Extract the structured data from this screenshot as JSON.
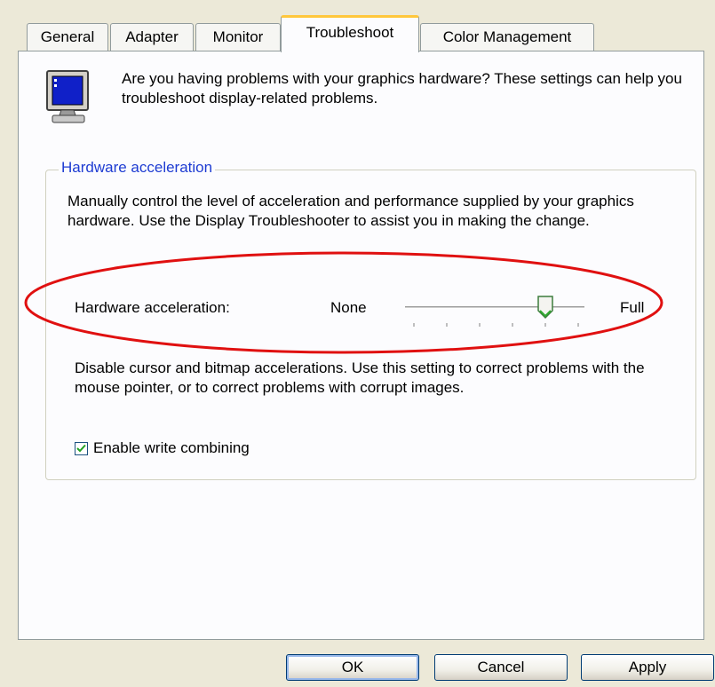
{
  "tabs": [
    {
      "label": "General"
    },
    {
      "label": "Adapter"
    },
    {
      "label": "Monitor"
    },
    {
      "label": "Troubleshoot",
      "active": true
    },
    {
      "label": "Color Management"
    }
  ],
  "intro_text": "Are you having problems with your graphics hardware? These settings can help you troubleshoot display-related problems.",
  "group": {
    "title": "Hardware acceleration",
    "description": "Manually control the level of acceleration and performance supplied by your graphics hardware. Use the Display Troubleshooter to assist you in making the change.",
    "slider_label": "Hardware acceleration:",
    "min_label": "None",
    "max_label": "Full",
    "slider_level": "5 of 6",
    "disable_text": "Disable cursor and bitmap accelerations. Use this setting to correct problems with the mouse pointer, or to correct problems with corrupt images.",
    "checkbox_label": "Enable write combining",
    "checkbox_checked": true
  },
  "buttons": {
    "ok": "OK",
    "cancel": "Cancel",
    "apply": "Apply"
  },
  "colors": {
    "highlight": "#E01010",
    "group_title": "#1E3CD2",
    "active_tab_accent": "#FFC73C"
  },
  "icons": [
    "monitor-icon",
    "slider-thumb-icon",
    "checkmark-icon"
  ]
}
